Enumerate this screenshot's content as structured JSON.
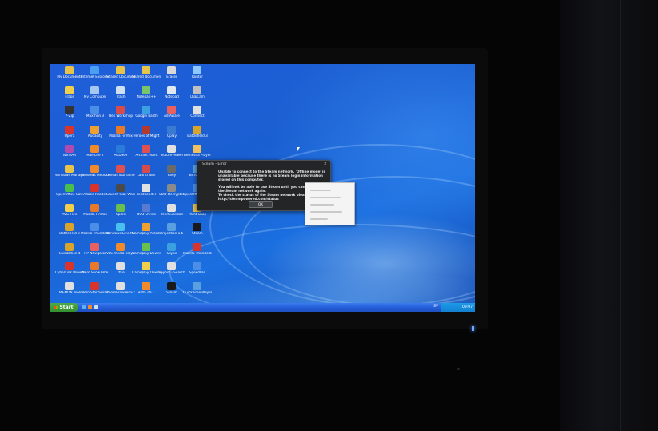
{
  "desktop": {
    "icons": [
      {
        "label": "My Documents",
        "color": "#e8c34a"
      },
      {
        "label": "Internet Explorer",
        "color": "#4aa0f0"
      },
      {
        "label": "Shared Documents",
        "color": "#e8c34a"
      },
      {
        "label": "Shared Documents",
        "color": "#e8c34a"
      },
      {
        "label": "Eraser",
        "color": "#d9d9d9"
      },
      {
        "label": "Router",
        "color": "#8fc7ff"
      },
      {
        "label": "Fraps",
        "color": "#f0d04a"
      },
      {
        "label": "My Computer",
        "color": "#a6c8f0"
      },
      {
        "label": "Trash",
        "color": "#cfe0f0"
      },
      {
        "label": "Notepad++",
        "color": "#7ac46a"
      },
      {
        "label": "Notepad",
        "color": "#e0e8f0"
      },
      {
        "label": "DigiCam",
        "color": "#c0c0c0"
      },
      {
        "label": "7-Zip",
        "color": "#333333"
      },
      {
        "label": "Maxthon 3",
        "color": "#4a8ee8"
      },
      {
        "label": "Hex Workshop",
        "color": "#d94a4a"
      },
      {
        "label": "Google Earth",
        "color": "#3aa0e0"
      },
      {
        "label": "Ad-Aware",
        "color": "#e86060"
      },
      {
        "label": "Connect",
        "color": "#e0e0e0"
      },
      {
        "label": "Opera",
        "color": "#d9342b"
      },
      {
        "label": "Audacity",
        "color": "#f0a030"
      },
      {
        "label": "Mozilla Firefox",
        "color": "#e8782a"
      },
      {
        "label": "Heroes of Might",
        "color": "#b03a2e"
      },
      {
        "label": "Uplay",
        "color": "#3a7ad0"
      },
      {
        "label": "Battlefield 3",
        "color": "#d9a42a"
      },
      {
        "label": "WinRAR",
        "color": "#b04ab0"
      },
      {
        "label": "Half-Life 2",
        "color": "#f08a2a"
      },
      {
        "label": "ACDSee",
        "color": "#2a7ad9"
      },
      {
        "label": "Artifact Wars",
        "color": "#e05050"
      },
      {
        "label": "PictureViewer",
        "color": "#e0e0e0"
      },
      {
        "label": "Bethesda Player",
        "color": "#f0c060"
      },
      {
        "label": "Windows Manager",
        "color": "#e8c34a"
      },
      {
        "label": "Windows Media Player",
        "color": "#f08a2a"
      },
      {
        "label": "Unreal Tournament",
        "color": "#e05050"
      },
      {
        "label": "Launch Bill",
        "color": "#d94a4a"
      },
      {
        "label": "Riley",
        "color": "#6a6a6a"
      },
      {
        "label": "BitTorrent",
        "color": "#5aa0e0"
      },
      {
        "label": "OpenOffice Calc",
        "color": "#4ac04a"
      },
      {
        "label": "Adobe Reader",
        "color": "#d9342b"
      },
      {
        "label": "Launch Star Wars",
        "color": "#4a4a4a"
      },
      {
        "label": "FeedReader",
        "color": "#e0e0e0"
      },
      {
        "label": "DVD Decrypter",
        "color": "#8a8a8a"
      },
      {
        "label": "OpenOffice Writer",
        "color": "#4a8ee8"
      },
      {
        "label": "AVG Free",
        "color": "#f0d04a"
      },
      {
        "label": "Mozilla Firefox",
        "color": "#e8782a"
      },
      {
        "label": "Spore",
        "color": "#6ac04a"
      },
      {
        "label": "DVD Shrink",
        "color": "#5a7ad0"
      },
      {
        "label": "PeerGuardian",
        "color": "#e0e0e0"
      },
      {
        "label": "Paint Shop",
        "color": "#e8c34a"
      },
      {
        "label": "Battlefield 2",
        "color": "#d9a42a"
      },
      {
        "label": "Mozilla Thunderbird",
        "color": "#4a8ee8"
      },
      {
        "label": "Windows Live Messenger",
        "color": "#4ac0f0"
      },
      {
        "label": "Gameplay Arcade",
        "color": "#f0a030"
      },
      {
        "label": "Projection 1.6",
        "color": "#5aa0e0"
      },
      {
        "label": "Steam",
        "color": "#1a1a1a"
      },
      {
        "label": "Civilization 4",
        "color": "#d9a42a"
      },
      {
        "label": "HP Navigator",
        "color": "#e86060"
      },
      {
        "label": "VLC media player",
        "color": "#f08a2a"
      },
      {
        "label": "Gameplay Download",
        "color": "#6ac04a"
      },
      {
        "label": "Skype",
        "color": "#3aa0e0"
      },
      {
        "label": "Mozilla Thunderbird",
        "color": "#d9342b"
      },
      {
        "label": "CyberLink PowerStarter",
        "color": "#d9342b"
      },
      {
        "label": "Nero ShowTime",
        "color": "#e8782a"
      },
      {
        "label": "Xfire",
        "color": "#e0e0e0"
      },
      {
        "label": "Gameplay Download",
        "color": "#f0d04a"
      },
      {
        "label": "Spybot - Search",
        "color": "#e0e0e0"
      },
      {
        "label": "SpeedFan",
        "color": "#4a8ee8"
      },
      {
        "label": "DAEMON Tools",
        "color": "#e0e0e0"
      },
      {
        "label": "Nero StartSmart",
        "color": "#d9342b"
      },
      {
        "label": "ZoomBrowser EX",
        "color": "#e0e0e0"
      },
      {
        "label": "Half-Life 2",
        "color": "#f08a2a"
      },
      {
        "label": "Steam",
        "color": "#1a1a1a"
      },
      {
        "label": "QuickTime Player",
        "color": "#5aa0e0"
      }
    ]
  },
  "dialog": {
    "title": "Steam - Error",
    "message": "Unable to connect to the Steam network. 'Offline mode' is unavailable because there is no Steam login information stored on this computer.\n\nYou will not be able to use Steam until you can connect to the Steam network again.\nTo check the status of the Steam network please visit\nhttp://steampowered.com/status",
    "ok_label": "OK"
  },
  "taskbar": {
    "start_label": "Start",
    "lang": "SV",
    "clock": "09:07"
  }
}
